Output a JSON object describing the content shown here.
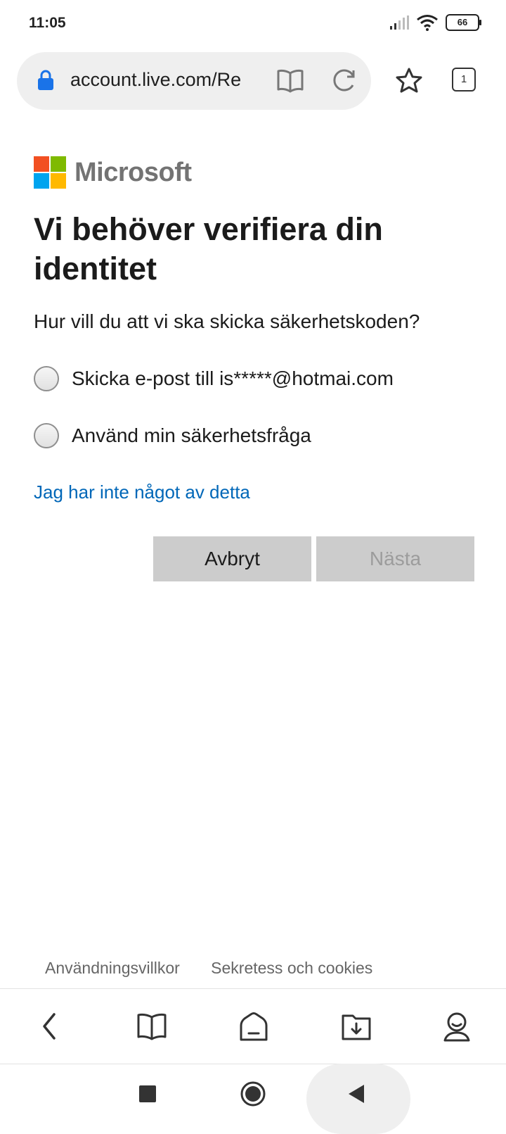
{
  "status_bar": {
    "time": "11:05",
    "battery": "66"
  },
  "browser": {
    "url": "account.live.com/Re",
    "tab_count": "1"
  },
  "page": {
    "logo_text": "Microsoft",
    "title": "Vi behöver verifiera din identitet",
    "subtitle": "Hur vill du att vi ska skicka säkerhetskoden?",
    "options": [
      {
        "label": "Skicka e-post till is*****@hotmai.com",
        "selected": false
      },
      {
        "label": "Använd min säkerhetsfråga",
        "selected": false
      }
    ],
    "link": "Jag har inte något av detta",
    "cancel_label": "Avbryt",
    "next_label": "Nästa",
    "footer": {
      "terms": "Användningsvillkor",
      "privacy": "Sekretess och cookies"
    }
  },
  "colors": {
    "link": "#0067b8",
    "button_bg": "#cccccc",
    "logo_red": "#f25022",
    "logo_green": "#7fba00",
    "logo_blue": "#00a4ef",
    "logo_yellow": "#ffb900"
  },
  "icons": {
    "browser_toolbar": [
      "lock-icon",
      "reader-mode-icon",
      "reload-icon",
      "bookmark-star-icon",
      "tabs-icon"
    ],
    "browser_nav": [
      "back-icon",
      "book-icon",
      "home-icon",
      "downloads-icon",
      "profile-icon"
    ],
    "system_nav": [
      "recents-icon",
      "home-circle-icon",
      "system-back-icon"
    ]
  }
}
